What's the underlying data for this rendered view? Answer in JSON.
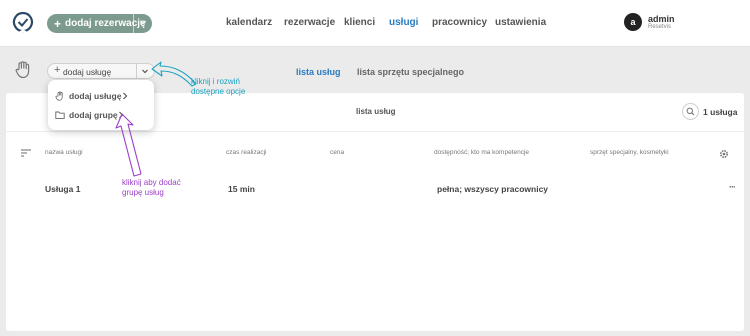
{
  "header": {
    "new_reservation_label": "dodaj rezerwację",
    "nav": [
      "kalendarz",
      "rezerwacje",
      "klienci",
      "usługi",
      "pracownicy",
      "ustawienia"
    ],
    "active_nav": "usługi",
    "user": {
      "avatar_letter": "a",
      "name": "admin",
      "company": "Resetvis"
    }
  },
  "toolbar": {
    "add_service_label": "dodaj usługę",
    "tabs": [
      "lista usług",
      "lista sprzętu specjalnego"
    ],
    "active_tab": "lista usług"
  },
  "dropdown": {
    "items": [
      {
        "label": "dodaj usługę",
        "icon": "hand-icon"
      },
      {
        "label": "dodaj grupę",
        "icon": "folder-icon"
      }
    ]
  },
  "panel": {
    "title": "lista usług",
    "count": "1 usługa",
    "columns": [
      "nazwa usługi",
      "czas realizacji",
      "cena",
      "dostępność; kto ma kompetencje",
      "sprzęt specjalny, kosmetyki"
    ],
    "rows": [
      {
        "name": "Usługa 1",
        "duration": "15 min",
        "price": "",
        "availability": "pełna; wszyscy pracownicy",
        "equipment": ""
      }
    ],
    "more_label": "···"
  },
  "annotations": {
    "cyan_text": [
      "kliknij i rozwiń",
      "dostępne opcje"
    ],
    "purple_text": [
      "kliknij aby dodać",
      "grupę usług"
    ]
  },
  "colors": {
    "accent": "#2b7bc0",
    "brand_button": "#7d9a8f",
    "annotation_cyan": "#1aa3c2",
    "annotation_purple": "#9b3fc8"
  }
}
